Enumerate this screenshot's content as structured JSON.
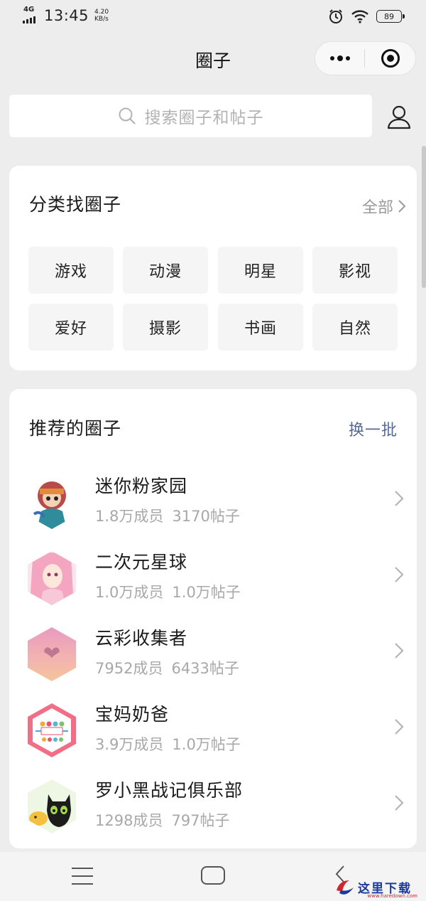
{
  "status_bar": {
    "network": "4G",
    "time": "13:45",
    "speed_value": "4.20",
    "speed_unit": "KB/s",
    "battery": "89"
  },
  "header": {
    "title": "圈子"
  },
  "search": {
    "placeholder": "搜索圈子和帖子"
  },
  "categories": {
    "title": "分类找圈子",
    "all_label": "全部",
    "items": [
      "游戏",
      "动漫",
      "明星",
      "影视",
      "爱好",
      "摄影",
      "书画",
      "自然"
    ]
  },
  "recommended": {
    "title": "推荐的圈子",
    "refresh_label": "换一批",
    "items": [
      {
        "name": "迷你粉家园",
        "members": "1.8万成员",
        "posts": "3170帖子"
      },
      {
        "name": "二次元星球",
        "members": "1.0万成员",
        "posts": "1.0万帖子"
      },
      {
        "name": "云彩收集者",
        "members": "7952成员",
        "posts": "6433帖子"
      },
      {
        "name": "宝妈奶爸",
        "members": "3.9万成员",
        "posts": "1.0万帖子"
      },
      {
        "name": "罗小黑战记俱乐部",
        "members": "1298成员",
        "posts": "797帖子"
      }
    ]
  },
  "watermark": {
    "text": "这里下载",
    "sub": "www.haredown.com"
  }
}
